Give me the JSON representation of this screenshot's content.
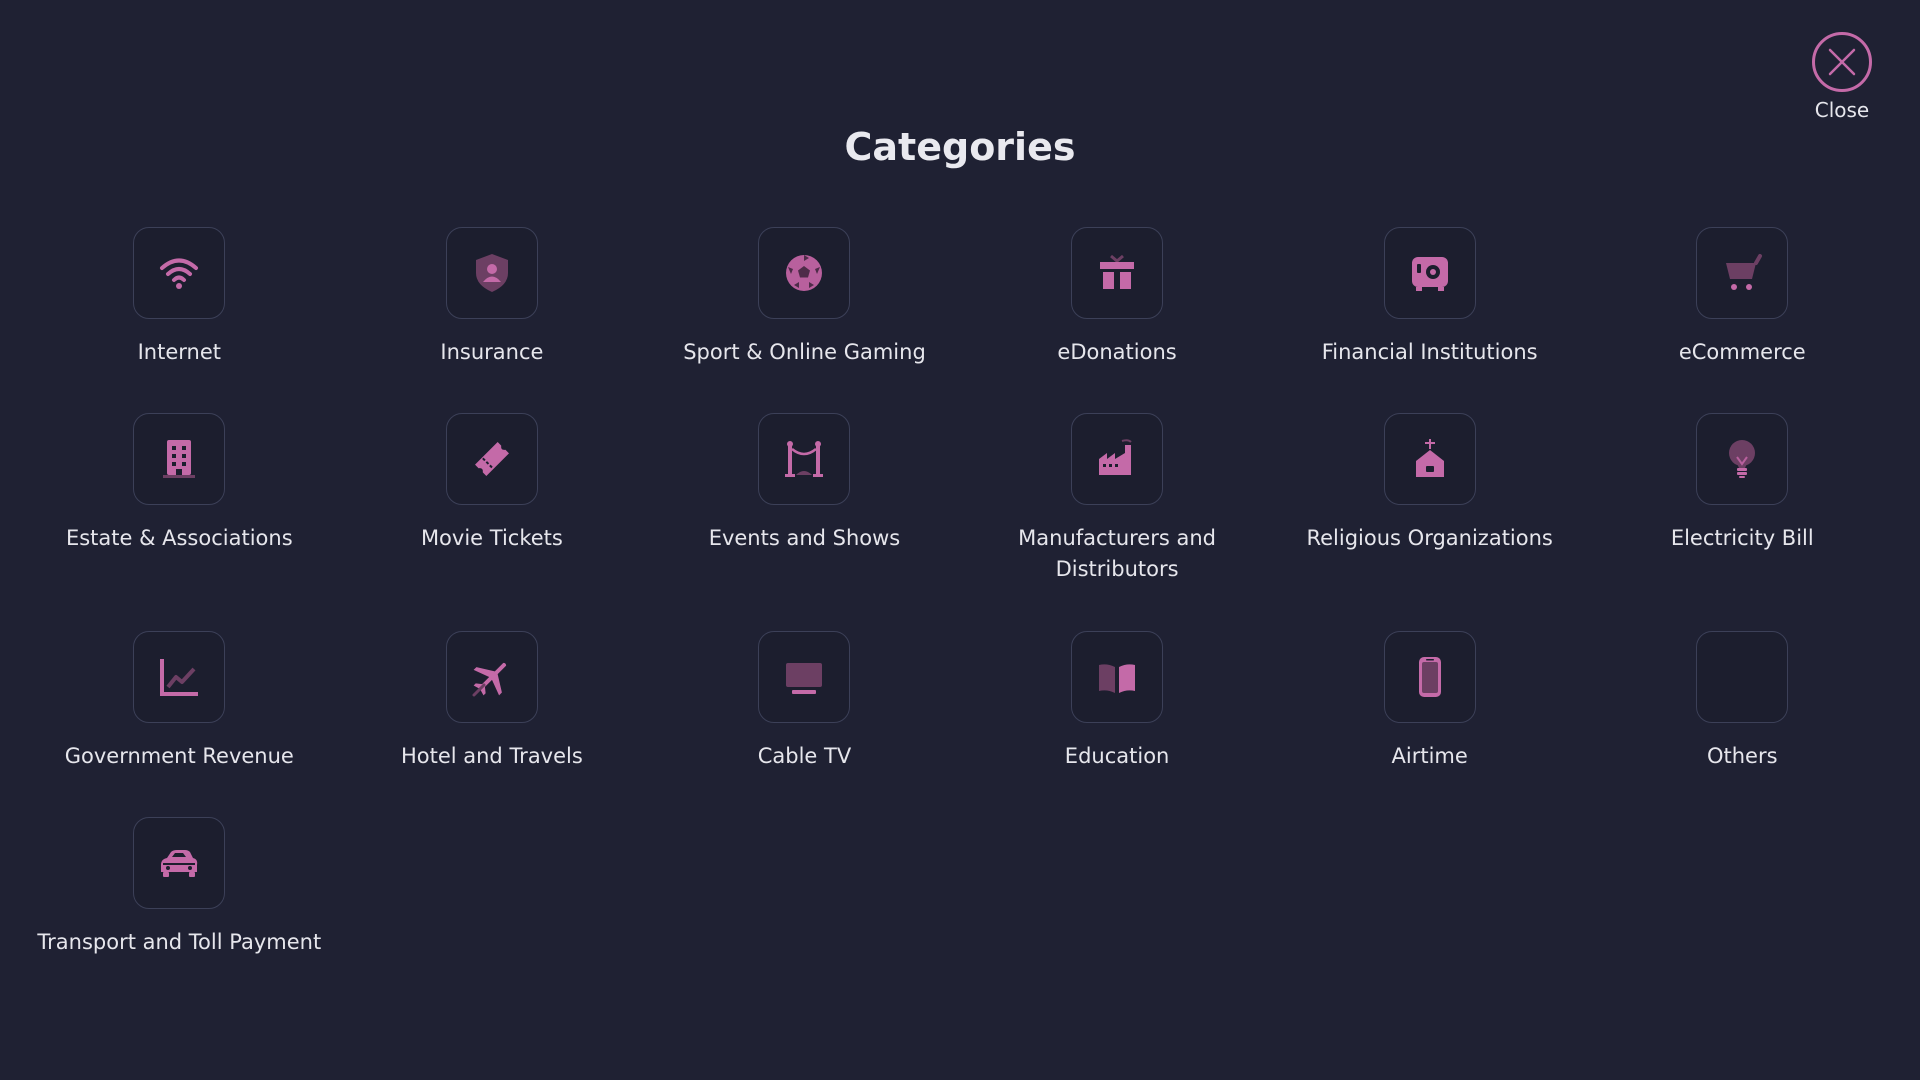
{
  "header": {
    "title": "Categories",
    "close_label": "Close"
  },
  "colors": {
    "background": "#1f2133",
    "accent": "#c46aa8",
    "icon_box_border": "#3c4058",
    "text": "#e6e6ec"
  },
  "categories": [
    {
      "label": "Internet",
      "icon": "wifi-icon"
    },
    {
      "label": "Insurance",
      "icon": "shield-user-icon"
    },
    {
      "label": "Sport & Online Gaming",
      "icon": "soccer-ball-icon"
    },
    {
      "label": "eDonations",
      "icon": "gift-icon"
    },
    {
      "label": "Financial Institutions",
      "icon": "safe-icon"
    },
    {
      "label": "eCommerce",
      "icon": "cart-icon"
    },
    {
      "label": "Estate & Associations",
      "icon": "building-icon"
    },
    {
      "label": "Movie Tickets",
      "icon": "ticket-icon"
    },
    {
      "label": "Events and Shows",
      "icon": "rope-barrier-icon"
    },
    {
      "label": "Manufacturers and Distributors",
      "icon": "factory-icon"
    },
    {
      "label": "Religious Organizations",
      "icon": "church-icon"
    },
    {
      "label": "Electricity Bill",
      "icon": "lightbulb-icon"
    },
    {
      "label": "Government Revenue",
      "icon": "chart-line-icon"
    },
    {
      "label": "Hotel and Travels",
      "icon": "plane-icon"
    },
    {
      "label": "Cable TV",
      "icon": "tv-icon"
    },
    {
      "label": "Education",
      "icon": "book-icon"
    },
    {
      "label": "Airtime",
      "icon": "phone-icon"
    },
    {
      "label": "Others",
      "icon": "blank-icon"
    },
    {
      "label": "Transport and Toll Payment",
      "icon": "car-icon"
    }
  ]
}
